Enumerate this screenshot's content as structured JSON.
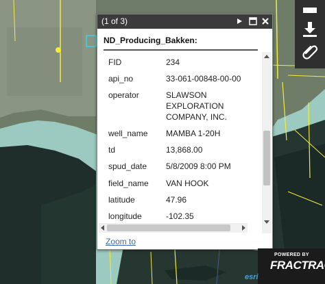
{
  "popup": {
    "counter": "(1 of 3)",
    "layer_title": "ND_Producing_Bakken:",
    "attributes": [
      {
        "name": "FID",
        "value": "234"
      },
      {
        "name": "api_no",
        "value": "33-061-00848-00-00"
      },
      {
        "name": "operator",
        "value": "SLAWSON EXPLORATION COMPANY, INC."
      },
      {
        "name": "well_name",
        "value": "MAMBA 1-20H"
      },
      {
        "name": "td",
        "value": "13,868.00"
      },
      {
        "name": "spud_date",
        "value": "5/8/2009 8:00 PM"
      },
      {
        "name": "field_name",
        "value": "VAN HOOK"
      },
      {
        "name": "latitude",
        "value": "47.96"
      },
      {
        "name": "longitude",
        "value": "-102.35"
      }
    ],
    "footer_link": "Zoom to"
  },
  "branding": {
    "powered_by": "POWERED BY",
    "logo": "FRACTRACK",
    "basemap_credit": "esri"
  },
  "icons": {
    "next": "play-icon",
    "maximize": "maximize-icon",
    "close": "close-icon",
    "download": "download-icon",
    "attach": "paperclip-icon"
  },
  "colors": {
    "water": "#9cc9c0",
    "land": "#2a3a34",
    "well_lines": "#f4ec3c",
    "popup_header": "#3b3b3b",
    "link": "#3a68b0"
  }
}
